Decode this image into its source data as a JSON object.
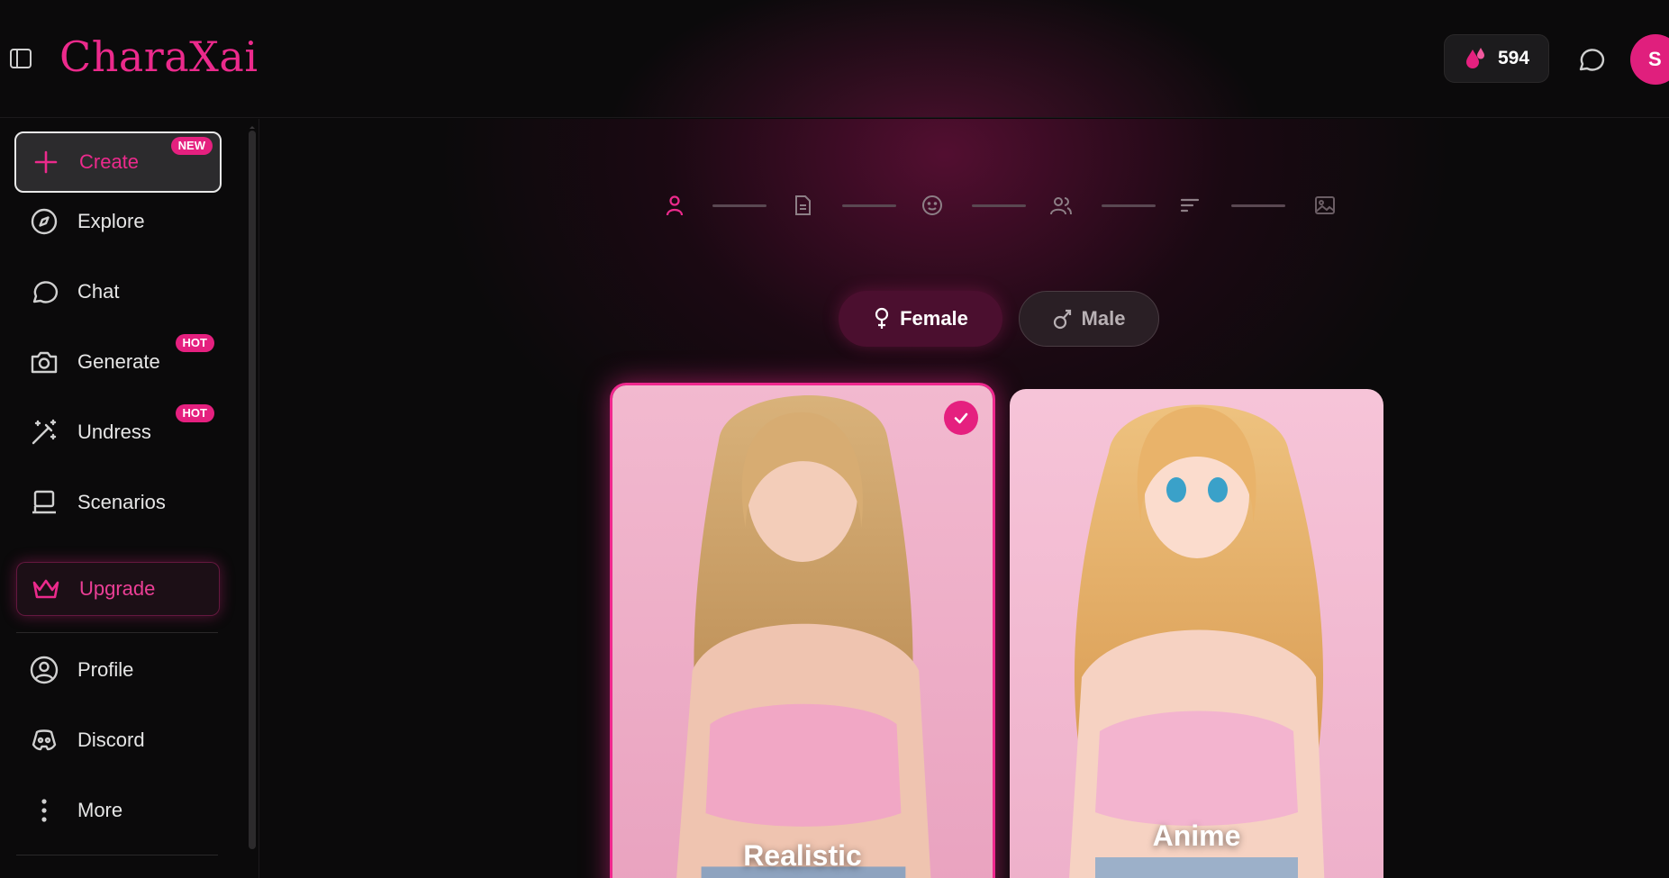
{
  "header": {
    "logo": "CharaXai",
    "credits": "594",
    "avatar_initial": "S"
  },
  "sidebar": {
    "create": {
      "label": "Create",
      "badge": "NEW"
    },
    "explore": {
      "label": "Explore"
    },
    "chat": {
      "label": "Chat"
    },
    "generate": {
      "label": "Generate",
      "badge": "HOT"
    },
    "undress": {
      "label": "Undress",
      "badge": "HOT"
    },
    "scenarios": {
      "label": "Scenarios"
    },
    "upgrade": {
      "label": "Upgrade"
    },
    "profile": {
      "label": "Profile"
    },
    "discord": {
      "label": "Discord"
    },
    "more": {
      "label": "More"
    }
  },
  "steps": {
    "icons": [
      "person-icon",
      "document-icon",
      "smile-icon",
      "people-icon",
      "lines-icon",
      "image-icon"
    ],
    "active_index": 0
  },
  "gender": {
    "female": "Female",
    "male": "Male",
    "selected": "Female"
  },
  "styles": {
    "realistic": {
      "label": "Realistic",
      "selected": true
    },
    "anime": {
      "label": "Anime",
      "selected": false
    }
  },
  "colors": {
    "accent": "#ec2a8c",
    "background": "#0b0a0b"
  }
}
